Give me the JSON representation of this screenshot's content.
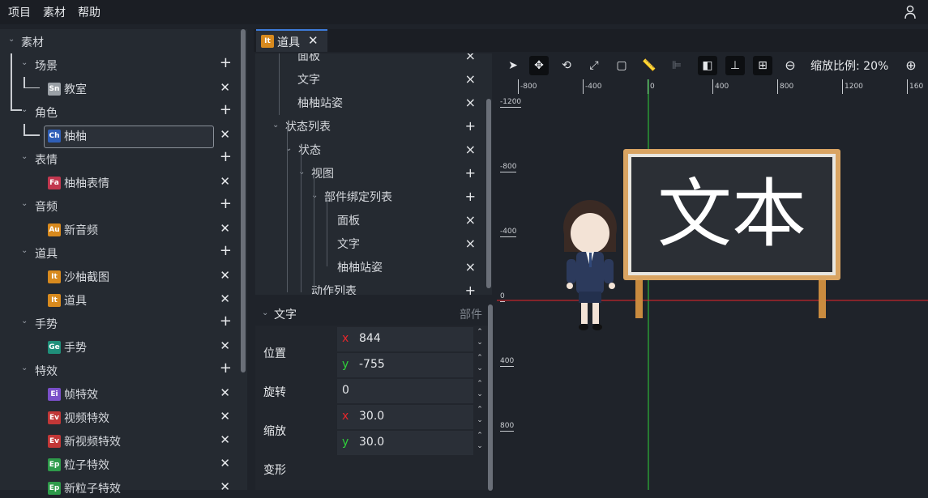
{
  "menu": {
    "items": [
      "项目",
      "素材",
      "帮助"
    ]
  },
  "tree": {
    "root": "素材",
    "rows": [
      {
        "label": "场景",
        "type": "group"
      },
      {
        "label": "教室",
        "badge": "Sn",
        "badge_color": "#9aa0a6"
      },
      {
        "label": "角色",
        "type": "group"
      },
      {
        "label": "柚柚",
        "badge": "Ch",
        "badge_color": "#2f5fb8"
      },
      {
        "label": "表情",
        "type": "group"
      },
      {
        "label": "柚柚表情",
        "badge": "Fa",
        "badge_color": "#c2374f"
      },
      {
        "label": "音频",
        "type": "group"
      },
      {
        "label": "新音频",
        "badge": "Au",
        "badge_color": "#d88a1e"
      },
      {
        "label": "道具",
        "type": "group"
      },
      {
        "label": "沙柚截图",
        "badge": "It",
        "badge_color": "#d88a1e"
      },
      {
        "label": "道具",
        "badge": "It",
        "badge_color": "#d88a1e"
      },
      {
        "label": "手势",
        "type": "group"
      },
      {
        "label": "手势",
        "badge": "Ge",
        "badge_color": "#1f8f7a"
      },
      {
        "label": "特效",
        "type": "group"
      },
      {
        "label": "帧特效",
        "badge": "Ei",
        "badge_color": "#7a4fc9"
      },
      {
        "label": "视频特效",
        "badge": "Ev",
        "badge_color": "#c23737"
      },
      {
        "label": "新视频特效",
        "badge": "Ev",
        "badge_color": "#c23737"
      },
      {
        "label": "粒子特效",
        "badge": "Ep",
        "badge_color": "#2e9a4a"
      },
      {
        "label": "新粒子特效",
        "badge": "Ep",
        "badge_color": "#2e9a4a"
      }
    ]
  },
  "tab": {
    "label": "道具",
    "badge": "It"
  },
  "mid_tree": {
    "rows": [
      {
        "label": "面板",
        "action": "×"
      },
      {
        "label": "文字",
        "action": "×"
      },
      {
        "label": "柚柚站姿",
        "action": "×"
      },
      {
        "label": "状态列表",
        "action": "+"
      },
      {
        "label": "状态",
        "action": "×"
      },
      {
        "label": "视图",
        "action": "+"
      },
      {
        "label": "部件绑定列表",
        "action": "+"
      },
      {
        "label": "面板",
        "action": "×"
      },
      {
        "label": "文字",
        "action": "×"
      },
      {
        "label": "柚柚站姿",
        "action": "×"
      },
      {
        "label": "动作列表",
        "action": "+"
      }
    ]
  },
  "props": {
    "title": "文字",
    "category": "部件",
    "position_label": "位置",
    "pos_x": "844",
    "pos_y": "-755",
    "rotation_label": "旋转",
    "rotation": "0",
    "scale_label": "缩放",
    "scale_x": "30.0",
    "scale_y": "30.0",
    "transform_label": "变形",
    "axis_x": "x",
    "axis_y": "y"
  },
  "toolbar": {
    "zoom_label": "缩放比例:",
    "zoom_value": "20%"
  },
  "ruler": {
    "x_ticks": [
      "-800",
      "-400",
      "0",
      "400",
      "800",
      "1200",
      "160"
    ],
    "y_ticks": [
      "-1200",
      "-800",
      "-400",
      "0",
      "400",
      "800"
    ]
  },
  "scene": {
    "board_text": "文本"
  },
  "colors": {
    "accent": "#3d7bd9",
    "axis_x": "#e8262b",
    "axis_y": "#2fd13a"
  }
}
